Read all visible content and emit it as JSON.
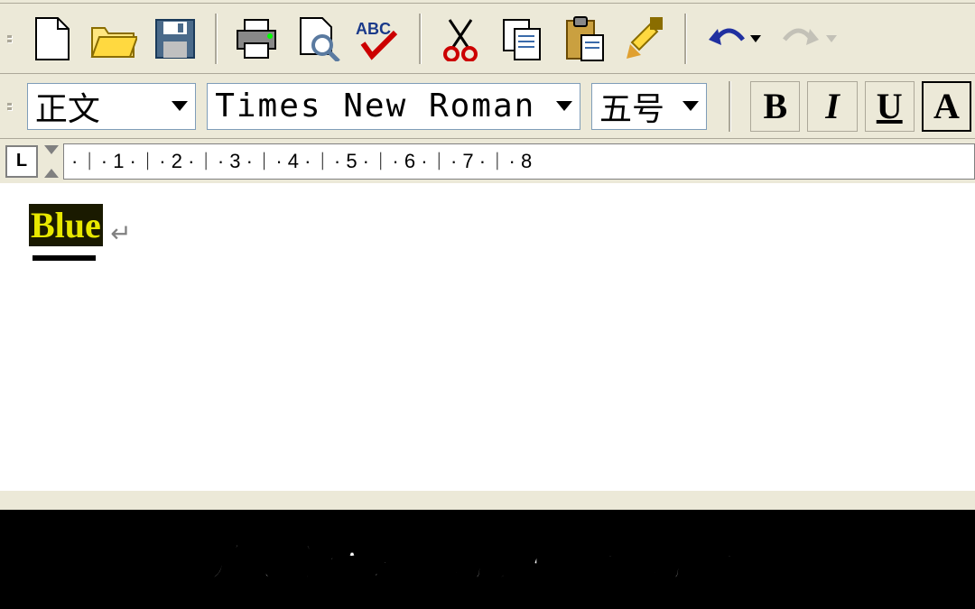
{
  "toolbar": {
    "new": "new",
    "open": "open",
    "save": "save",
    "print": "print",
    "preview": "preview",
    "spell": "spell",
    "cut": "cut",
    "copy": "copy",
    "paste": "paste",
    "format_painter": "format-painter",
    "undo": "undo",
    "redo": "redo"
  },
  "format": {
    "style": "正文",
    "font": "Times New Roman",
    "size": "五号",
    "bold": "B",
    "italic": "I",
    "underline": "U",
    "font_box": "A"
  },
  "ruler": {
    "tab_mode": "L",
    "scale": "· ᛁ · 1 · ᛁ · 2 · ᛁ · 3 · ᛁ · 4 · ᛁ · 5 · ᛁ · 6 · ᛁ · 7 · ᛁ · 8"
  },
  "document": {
    "selected_text": "Blue",
    "paragraph_mark": "↵"
  },
  "caption": "并把字体设置为加粗颜色为蓝色"
}
